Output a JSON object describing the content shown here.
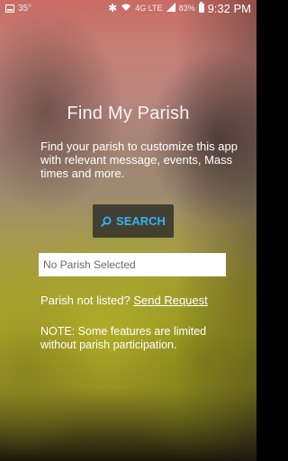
{
  "status_bar": {
    "temperature": "35°",
    "network_type": "4G LTE",
    "battery_percent": "83%",
    "time": "9:32 PM",
    "icons": [
      "gallery-icon",
      "bluetooth-icon",
      "wifi-icon",
      "signal-icon",
      "battery-icon"
    ]
  },
  "main": {
    "title": "Find My Parish",
    "intro": "Find your parish to customize this app with relevant message, events, Mass times and more.",
    "search_label": "SEARCH",
    "parish_value": "No Parish Selected",
    "not_listed_text": "Parish not listed?",
    "send_request_label": "Send Request",
    "note": "NOTE: Some features are limited without parish participation."
  },
  "colors": {
    "accent": "#35b4ef",
    "button_bg": "#2a2a2a",
    "field_bg": "#ffffff"
  }
}
